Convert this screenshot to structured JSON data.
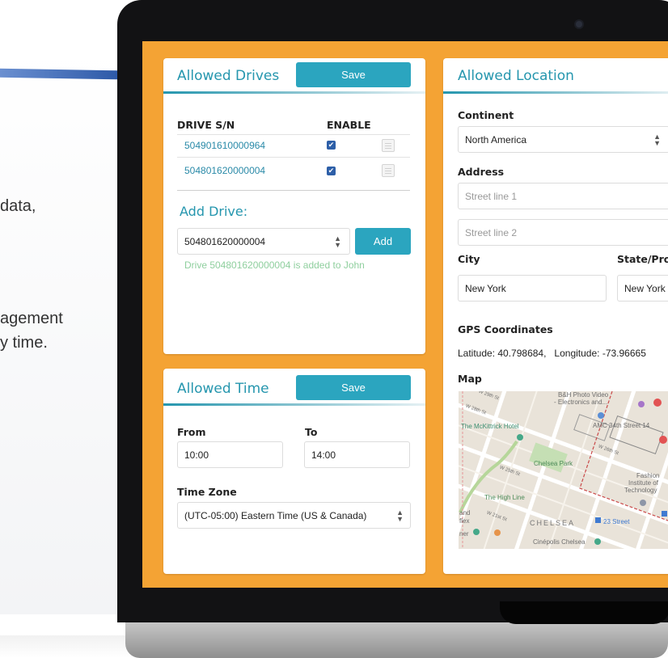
{
  "background_copy": {
    "line1": "data,",
    "line2": "agement",
    "line3": "y time."
  },
  "allowed_drives": {
    "title": "Allowed Drives",
    "save_label": "Save",
    "col_sn": "DRIVE S/N",
    "col_enable": "ENABLE",
    "drives": [
      {
        "sn": "504901610000964",
        "enabled": true
      },
      {
        "sn": "504801620000004",
        "enabled": true
      }
    ],
    "add_title": "Add Drive:",
    "add_select_value": "504801620000004",
    "add_label": "Add",
    "status_message": "Drive 504801620000004 is added to John"
  },
  "allowed_time": {
    "title": "Allowed Time",
    "save_label": "Save",
    "from_label": "From",
    "from_value": "10:00",
    "to_label": "To",
    "to_value": "14:00",
    "timezone_label": "Time Zone",
    "timezone_value": "(UTC-05:00) Eastern Time (US & Canada)"
  },
  "allowed_location": {
    "title": "Allowed Location",
    "continent_label": "Continent",
    "continent_value": "North America",
    "address_label": "Address",
    "street1_placeholder": "Street line 1",
    "street2_placeholder": "Street line 2",
    "city_label": "City",
    "city_value": "New York",
    "state_label": "State/Pro",
    "state_value": "New York",
    "gps_label": "GPS Coordinates",
    "gps_value": "Latitude: 40.798684,   Longitude: -73.96665",
    "map_label": "Map",
    "map_labels": {
      "bh1": "B&H Photo Video",
      "bh2": "- Electronics and...",
      "mckittrick": "The McKittrick Hotel",
      "amc": "AMC 34th Street 14",
      "chelsea_park": "Chelsea Park",
      "fashion1": "Fashion",
      "fashion2": "Institute of",
      "fashion3": "Technology",
      "high_line": "The High Line",
      "chelsea": "CHELSEA",
      "street23": "23 Street",
      "cinepolis": "Cinépolis Chelsea",
      "w29": "W 29th St",
      "w28": "W 28th St",
      "w26": "W 26th St",
      "w25": "W 25th St",
      "w21": "W 21st St",
      "and": "and",
      "flex": "flex",
      "ner": "ner"
    }
  },
  "colors": {
    "screen_orange": "#f4a334",
    "accent_teal": "#2596ae",
    "button_teal": "#2ba5bf",
    "success_green": "#8fcf9e",
    "checkbox_blue": "#2d5fa8"
  }
}
